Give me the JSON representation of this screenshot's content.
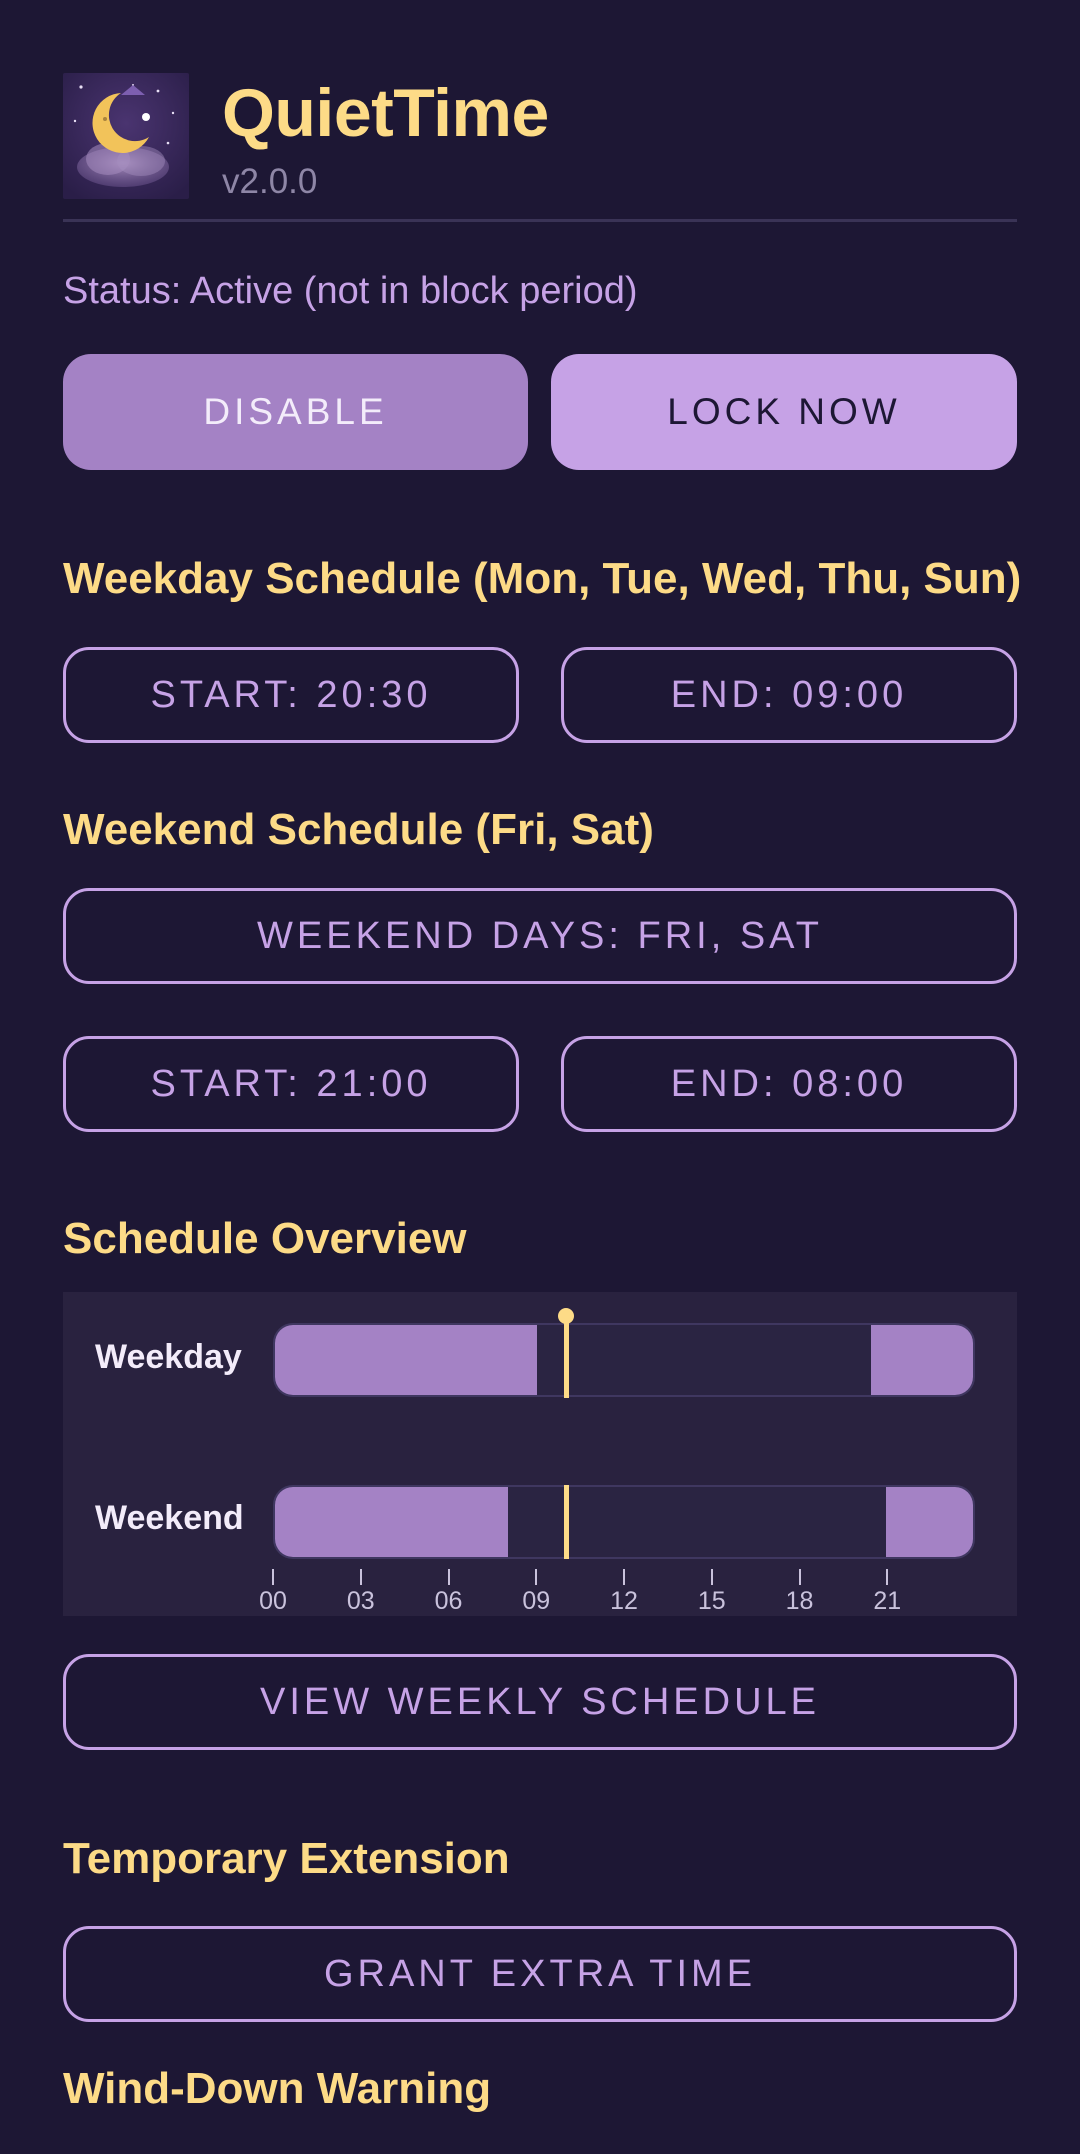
{
  "header": {
    "app_name": "QuietTime",
    "version": "v2.0.0",
    "icon": "moon-cloud-app-icon"
  },
  "status": {
    "text": "Status: Active (not in block period)"
  },
  "actions": {
    "disable_label": "DISABLE",
    "lock_label": "LOCK NOW"
  },
  "weekday": {
    "heading": "Weekday Schedule (Mon, Tue, Wed, Thu, Sun)",
    "start_label": "START: 20:30",
    "end_label": "END: 09:00"
  },
  "weekend": {
    "heading": "Weekend Schedule (Fri, Sat)",
    "days_label": "WEEKEND DAYS: FRI, SAT",
    "start_label": "START: 21:00",
    "end_label": "END: 08:00"
  },
  "overview": {
    "heading": "Schedule Overview",
    "rows": [
      {
        "label": "Weekday",
        "blocks": [
          [
            0,
            9
          ],
          [
            20.5,
            24
          ]
        ]
      },
      {
        "label": "Weekend",
        "blocks": [
          [
            0,
            8
          ],
          [
            21,
            24
          ]
        ]
      }
    ],
    "current_hour": 10,
    "ticks": [
      "00",
      "03",
      "06",
      "09",
      "12",
      "15",
      "18",
      "21"
    ],
    "tick_hours": [
      0,
      3,
      6,
      9,
      12,
      15,
      18,
      21
    ],
    "hours_total": 24
  },
  "weekly": {
    "view_label": "VIEW WEEKLY SCHEDULE"
  },
  "extension": {
    "heading": "Temporary Extension",
    "grant_label": "GRANT EXTRA TIME"
  },
  "winddown": {
    "heading": "Wind-Down Warning"
  },
  "colors": {
    "background": "#1d1734",
    "accent_yellow": "#fddb87",
    "accent_purple": "#c6a2e6",
    "block_purple": "#a482c5"
  }
}
